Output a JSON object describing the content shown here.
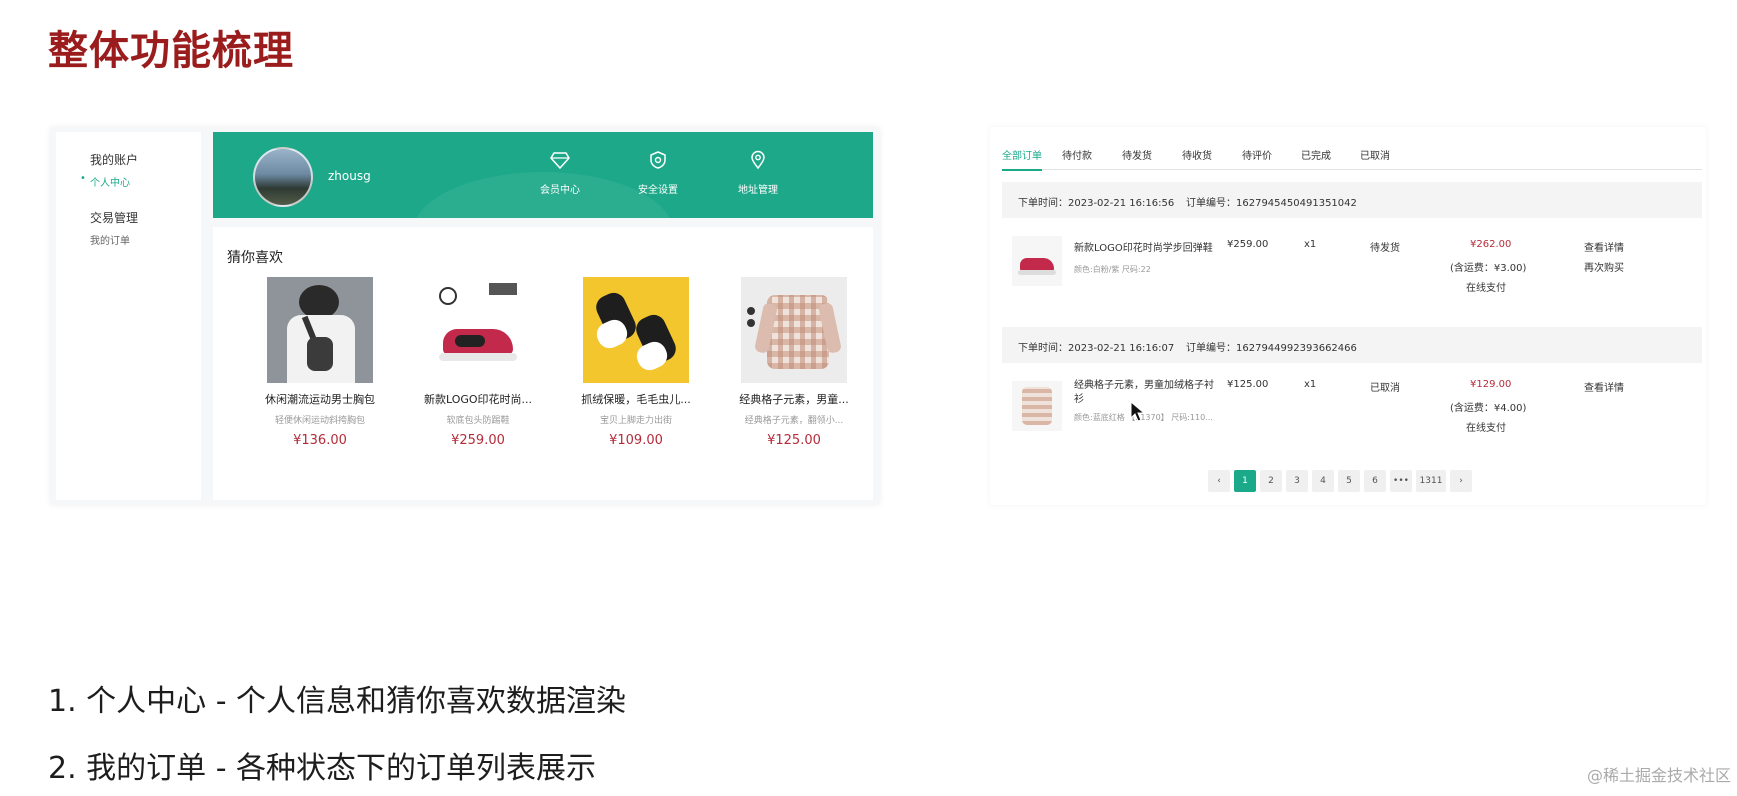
{
  "slide": {
    "title": "整体功能梳理"
  },
  "profile": {
    "sidebar": {
      "account_heading": "我的账户",
      "account_items": [
        "个人中心"
      ],
      "trade_heading": "交易管理",
      "trade_items": [
        "我的订单"
      ]
    },
    "username": "zhousg",
    "quick_links": [
      {
        "label": "会员中心",
        "icon": "diamond-icon"
      },
      {
        "label": "安全设置",
        "icon": "shield-icon"
      },
      {
        "label": "地址管理",
        "icon": "location-pin-icon"
      }
    ],
    "guess_title": "猜你喜欢",
    "products": [
      {
        "name": "休闲潮流运动男士胸包",
        "desc": "轻便休闲运动斜挎胸包",
        "price": "¥136.00"
      },
      {
        "name": "新款LOGO印花时尚...",
        "desc": "软底包头防踢鞋",
        "price": "¥259.00"
      },
      {
        "name": "抓绒保暖，毛毛虫儿...",
        "desc": "宝贝上脚走力出街",
        "price": "¥109.00"
      },
      {
        "name": "经典格子元素，男童...",
        "desc": "经典格子元素，翻领小...",
        "price": "¥125.00"
      }
    ]
  },
  "orders": {
    "tabs": [
      "全部订单",
      "待付款",
      "待发货",
      "待收货",
      "待评价",
      "已完成",
      "已取消"
    ],
    "list": [
      {
        "time": "下单时间：2023-02-21 16:16:56",
        "number": "订单编号：1627945450491351042",
        "name": "新款LOGO印花时尚学步回弹鞋",
        "spec": "颜色:白粉/紫 尺码:22",
        "unit_price": "¥259.00",
        "qty": "x1",
        "status": "待发货",
        "total": "¥262.00",
        "freight": "(含运费：¥3.00)",
        "payment": "在线支付",
        "actions": [
          "查看详情",
          "再次购买"
        ]
      },
      {
        "time": "下单时间：2023-02-21 16:16:07",
        "number": "订单编号：1627944992393662466",
        "name": "经典格子元素，男童加绒格子衬衫",
        "spec": "颜色:蓝底红格 【21370】 尺码:110...",
        "unit_price": "¥125.00",
        "qty": "x1",
        "status": "已取消",
        "total": "¥129.00",
        "freight": "(含运费：¥4.00)",
        "payment": "在线支付",
        "actions": [
          "查看详情"
        ]
      }
    ],
    "pagination": {
      "prev": "‹",
      "pages": [
        "1",
        "2",
        "3",
        "4",
        "5",
        "6",
        "•••",
        "1311"
      ],
      "current": "1",
      "next": "›"
    }
  },
  "bullets": [
    "1.  个人中心 - 个人信息和猜你喜欢数据渲染",
    "2.  我的订单 - 各种状态下的订单列表展示"
  ],
  "watermark": "@稀土掘金技术社区",
  "colors": {
    "accent": "#1aaa8a",
    "title": "#9b1c1c",
    "price": "#b42c3a"
  }
}
